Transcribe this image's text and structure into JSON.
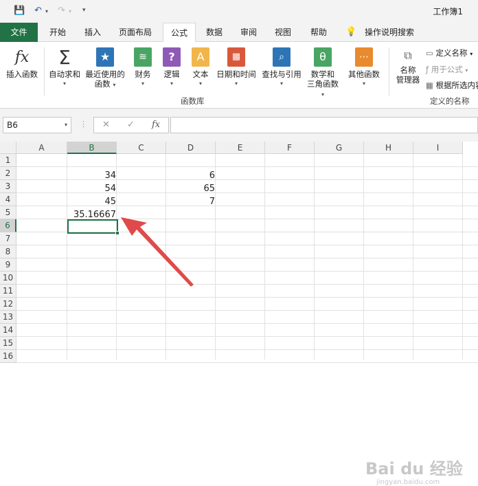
{
  "quick_access": {
    "save_icon": "save-icon",
    "undo_icon": "undo-icon",
    "redo_icon": "redo-icon",
    "customize_icon": "customize-qat-icon"
  },
  "window": {
    "title": "工作簿1"
  },
  "tabs": [
    {
      "label": "文件"
    },
    {
      "label": "开始"
    },
    {
      "label": "插入"
    },
    {
      "label": "页面布局"
    },
    {
      "label": "公式"
    },
    {
      "label": "数据"
    },
    {
      "label": "审阅"
    },
    {
      "label": "视图"
    },
    {
      "label": "帮助"
    },
    {
      "label": "操作说明搜索"
    }
  ],
  "ribbon": {
    "insert_function": "插入函数",
    "autosum": "自动求和",
    "recent_l1": "最近使用的",
    "recent_l2": "函数",
    "financial": "财务",
    "logical": "逻辑",
    "text": "文本",
    "datetime": "日期和时间",
    "lookup": "查找与引用",
    "math_l1": "数学和",
    "math_l2": "三角函数",
    "more": "其他函数",
    "library_group": "函数库",
    "name_mgr_l1": "名称",
    "name_mgr_l2": "管理器",
    "define_name": "定义名称",
    "use_in_formula": "用于公式",
    "create_from_selection": "根据所选内容",
    "defined_names_group": "定义的名称",
    "colors": {
      "autosum": "#333333",
      "recent": "#2e75b6",
      "financial": "#4aa564",
      "logical": "#8e5ab6",
      "text": "#f0b64c",
      "datetime": "#d9583b",
      "lookup": "#2e75b6",
      "math": "#4aa564",
      "more": "#e98a2e"
    }
  },
  "formula_bar": {
    "name_box": "B6",
    "fx": "fx",
    "cancel": "✕",
    "enter": "✓"
  },
  "sheet": {
    "columns": [
      "A",
      "B",
      "C",
      "D",
      "E",
      "F",
      "G",
      "H",
      "I"
    ],
    "rows": [
      "1",
      "2",
      "3",
      "4",
      "5",
      "6",
      "7",
      "8",
      "9",
      "10",
      "11",
      "12",
      "13",
      "14",
      "15",
      "16"
    ],
    "b2": "34",
    "b3": "54",
    "b4": "45",
    "b5": "35.16667",
    "d2": "6",
    "d3": "65",
    "d4": "7",
    "selected_cell": "B6"
  },
  "watermark": {
    "brand": "Bai du 经验",
    "url": "jingyan.baidu.com"
  }
}
